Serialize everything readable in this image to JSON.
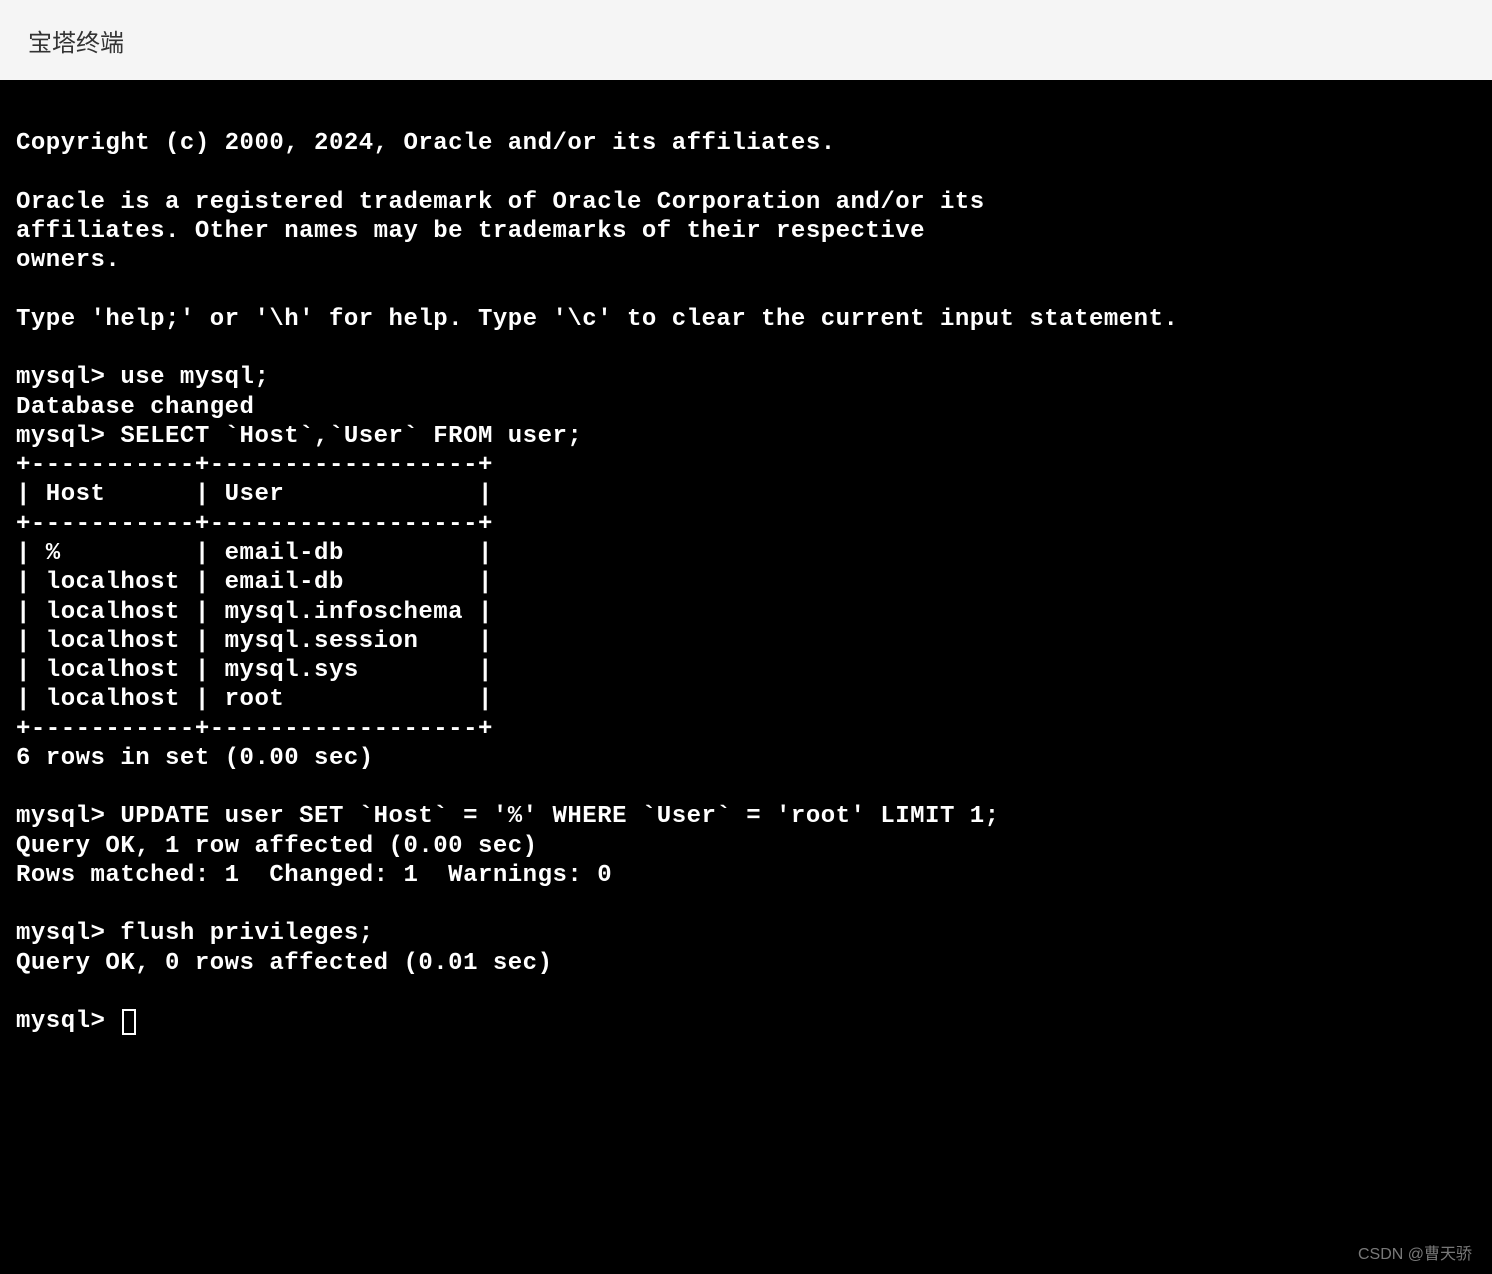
{
  "header": {
    "title": "宝塔终端"
  },
  "terminal": {
    "lines": [
      "",
      "Copyright (c) 2000, 2024, Oracle and/or its affiliates.",
      "",
      "Oracle is a registered trademark of Oracle Corporation and/or its",
      "affiliates. Other names may be trademarks of their respective",
      "owners.",
      "",
      "Type 'help;' or '\\h' for help. Type '\\c' to clear the current input statement.",
      "",
      "mysql> use mysql;",
      "Database changed",
      "mysql> SELECT `Host`,`User` FROM user;",
      "+-----------+------------------+",
      "| Host      | User             |",
      "+-----------+------------------+",
      "| %         | email-db         |",
      "| localhost | email-db         |",
      "| localhost | mysql.infoschema |",
      "| localhost | mysql.session    |",
      "| localhost | mysql.sys        |",
      "| localhost | root             |",
      "+-----------+------------------+",
      "6 rows in set (0.00 sec)",
      "",
      "mysql> UPDATE user SET `Host` = '%' WHERE `User` = 'root' LIMIT 1;",
      "Query OK, 1 row affected (0.00 sec)",
      "Rows matched: 1  Changed: 1  Warnings: 0",
      "",
      "mysql> flush privileges;",
      "Query OK, 0 rows affected (0.01 sec)",
      "",
      "mysql> "
    ],
    "prompt": "mysql> "
  },
  "watermark": "CSDN @曹天骄"
}
